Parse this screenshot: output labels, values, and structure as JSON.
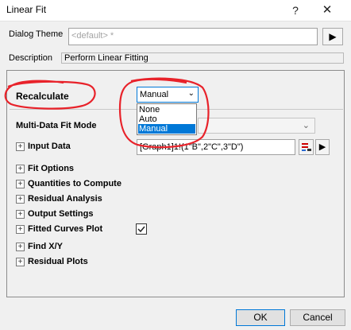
{
  "window": {
    "title": "Linear Fit",
    "help_glyph": "?",
    "close_glyph": "✕"
  },
  "theme": {
    "label": "Dialog Theme",
    "value": "<default> *",
    "arrow": "▶"
  },
  "description": {
    "label": "Description",
    "value": "Perform Linear Fitting"
  },
  "recalculate": {
    "label": "Recalculate",
    "selected": "Manual",
    "options": [
      "None",
      "Auto",
      "Manual"
    ],
    "highlighted_option": "Manual"
  },
  "multi_data": {
    "label": "Multi-Data Fit Mode",
    "value": ""
  },
  "input_data": {
    "label": "Input Data",
    "value": "[Graph1]1!(1\"B\",2\"C\",3\"D\")",
    "arrow": "▶"
  },
  "sections": [
    {
      "label": "Fit Options"
    },
    {
      "label": "Quantities to Compute"
    },
    {
      "label": "Residual Analysis"
    },
    {
      "label": "Output Settings"
    },
    {
      "label": "Fitted Curves Plot",
      "checked": true
    },
    {
      "label": "Find X/Y"
    },
    {
      "label": "Residual Plots"
    }
  ],
  "buttons": {
    "ok": "OK",
    "cancel": "Cancel"
  },
  "colors": {
    "annotation": "#e8222a",
    "selection": "#0078d7"
  }
}
